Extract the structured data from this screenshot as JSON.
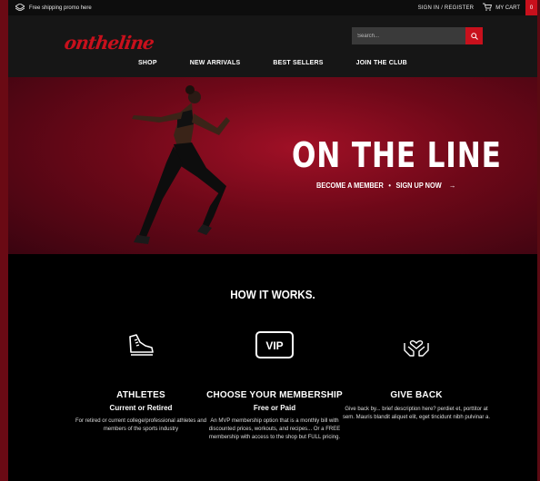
{
  "topbar": {
    "promo": "Free shipping promo here",
    "signin": "SIGN IN / REGISTER",
    "cart_label": "MY CART",
    "cart_count": "0"
  },
  "header": {
    "logo": "ontheline",
    "search_placeholder": "Search...",
    "nav": [
      "SHOP",
      "NEW ARRIVALS",
      "BEST SELLERS",
      "JOIN THE CLUB"
    ]
  },
  "hero": {
    "title": "ON THE LINE",
    "link_member": "BECOME A MEMBER",
    "separator": "•",
    "link_signup": "SIGN UP NOW",
    "arrow": "→"
  },
  "how": {
    "title": "HOW IT WORKS.",
    "columns": [
      {
        "icon": "sneaker-icon",
        "heading": "ATHLETES",
        "sub": "Current or Retired",
        "desc": "For retired or current college/professional athletes and members of the sports industry"
      },
      {
        "icon": "vip-badge-icon",
        "heading": "CHOOSE YOUR MEMBERSHIP",
        "sub": "Free or Paid",
        "desc": "An MVP membership option that is a monthly bill with discounted prices, workouts, and recipes... Or a FREE membership with access to the shop but FULL pricing.",
        "badge": "VIP"
      },
      {
        "icon": "heart-hands-icon",
        "heading": "GIVE BACK",
        "sub": "",
        "desc": "Give back by... brief description here? perdiet et, porttitor at sem. Mauris blandit aliquet elit, eget tincidunt nibh pulvinar a."
      }
    ]
  },
  "colors": {
    "accent": "#c8101c",
    "dark": "#161616",
    "black": "#000000"
  }
}
